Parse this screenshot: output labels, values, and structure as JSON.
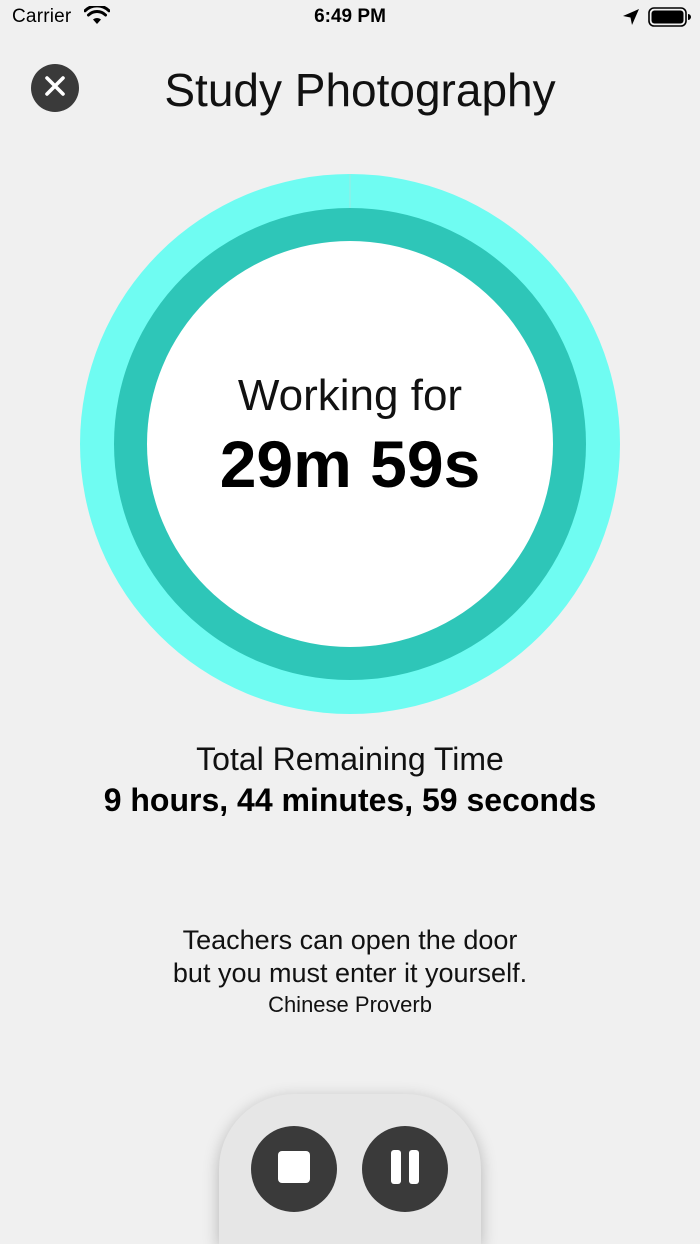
{
  "status_bar": {
    "carrier": "Carrier",
    "time": "6:49 PM",
    "icons": [
      "wifi-icon",
      "location-icon",
      "battery-icon"
    ]
  },
  "header": {
    "title": "Study Photography",
    "close_icon": "close-icon"
  },
  "timer": {
    "label": "Working for",
    "elapsed": "29m 59s",
    "progress": 0.0
  },
  "remaining": {
    "label": "Total Remaining Time",
    "value": "9 hours, 44 minutes, 59 seconds"
  },
  "quote": {
    "line1": "Teachers can open the door",
    "line2": "but you must enter it yourself.",
    "author": "Chinese Proverb"
  },
  "controls": {
    "stop_icon": "stop-icon",
    "pause_icon": "pause-icon"
  },
  "colors": {
    "background": "#f0f0f0",
    "outer_ring": "#6ffcf2",
    "inner_ring": "#2ec6b8",
    "button_dark": "#3a3a3a",
    "control_panel": "#e6e6e6"
  }
}
